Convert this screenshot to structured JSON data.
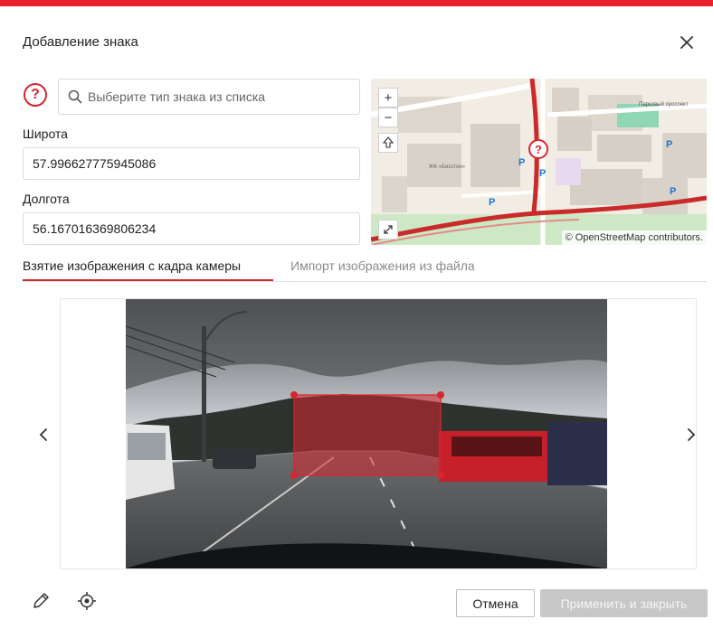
{
  "colors": {
    "accent": "#d7262f",
    "topbar": "#e8202c",
    "disabled": "#c7c7c7"
  },
  "dialog": {
    "title": "Добавление знака"
  },
  "sign_type": {
    "icon": "question-circle-icon",
    "search_placeholder": "Выберите тип знака из списка"
  },
  "latitude": {
    "label": "Широта",
    "value": "57.996627775945086"
  },
  "longitude": {
    "label": "Долгота",
    "value": "56.167016369806234"
  },
  "map": {
    "zoom_in": "+",
    "zoom_out": "−",
    "attribution": "© OpenStreetMap contributors.",
    "labels": {
      "street": "Парковый проспект",
      "building": "ЖК «Бисстон»"
    }
  },
  "tabs": [
    {
      "label": "Взятие изображения с кадра камеры",
      "active": true
    },
    {
      "label": "Импорт изображения из файла",
      "active": false
    }
  ],
  "buttons": {
    "cancel": "Отмена",
    "apply": "Применить и закрыть"
  }
}
